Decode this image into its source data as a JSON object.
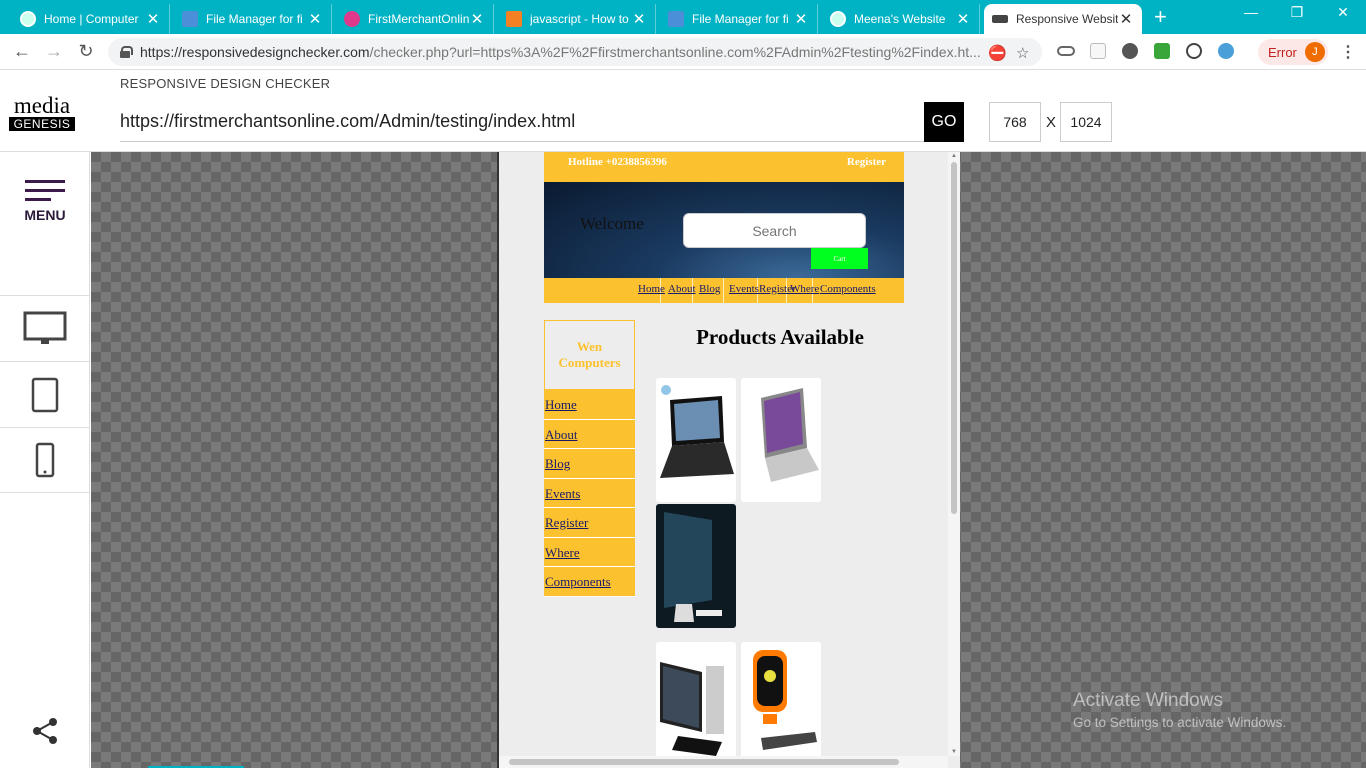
{
  "browser": {
    "tabs": [
      {
        "title": "Home | Computer",
        "fav_color": "#ffffff"
      },
      {
        "title": "File Manager for fi",
        "fav_color": "#4a8fd8"
      },
      {
        "title": "FirstMerchantOnlin",
        "fav_color": "#e0388a"
      },
      {
        "title": "javascript - How to",
        "fav_color": "#f48024"
      },
      {
        "title": "File Manager for fi",
        "fav_color": "#4a8fd8"
      },
      {
        "title": "Meena's Website",
        "fav_color": "#ffffff"
      },
      {
        "title": "Responsive Websit",
        "fav_color": "#444444"
      }
    ],
    "url_host": "https://responsivedesignchecker.com",
    "url_path": "/checker.php?url=https%3A%2F%2Ffirstmerchantsonline.com%2FAdmin%2Ftesting%2Findex.ht...",
    "profile_status": "Error",
    "profile_initial": "J"
  },
  "rdc": {
    "logo_top": "media",
    "logo_bottom": "GENESIS",
    "app_title": "RESPONSIVE DESIGN CHECKER",
    "url_value": "https://firstmerchantsonline.com/Admin/testing/index.html",
    "go_label": "GO",
    "width_value": "768",
    "by_label": "X",
    "height_value": "1024",
    "menu_label": "MENU"
  },
  "site": {
    "hotline": "Hotline +0238856396",
    "register_top": "Register",
    "welcome": "Welcome",
    "search_placeholder": "Search",
    "cart_label": "Cart",
    "nav": [
      "Home",
      "About",
      "Blog",
      "Events",
      "Register",
      "Where",
      "Components"
    ],
    "brand": "Wen Computers",
    "side_links": [
      "Home",
      "About",
      "Blog",
      "Events",
      "Register",
      "Where",
      "Components"
    ],
    "products_title": "Products Available"
  },
  "os": {
    "watermark_title": "Activate Windows",
    "watermark_sub": "Go to Settings to activate Windows."
  }
}
